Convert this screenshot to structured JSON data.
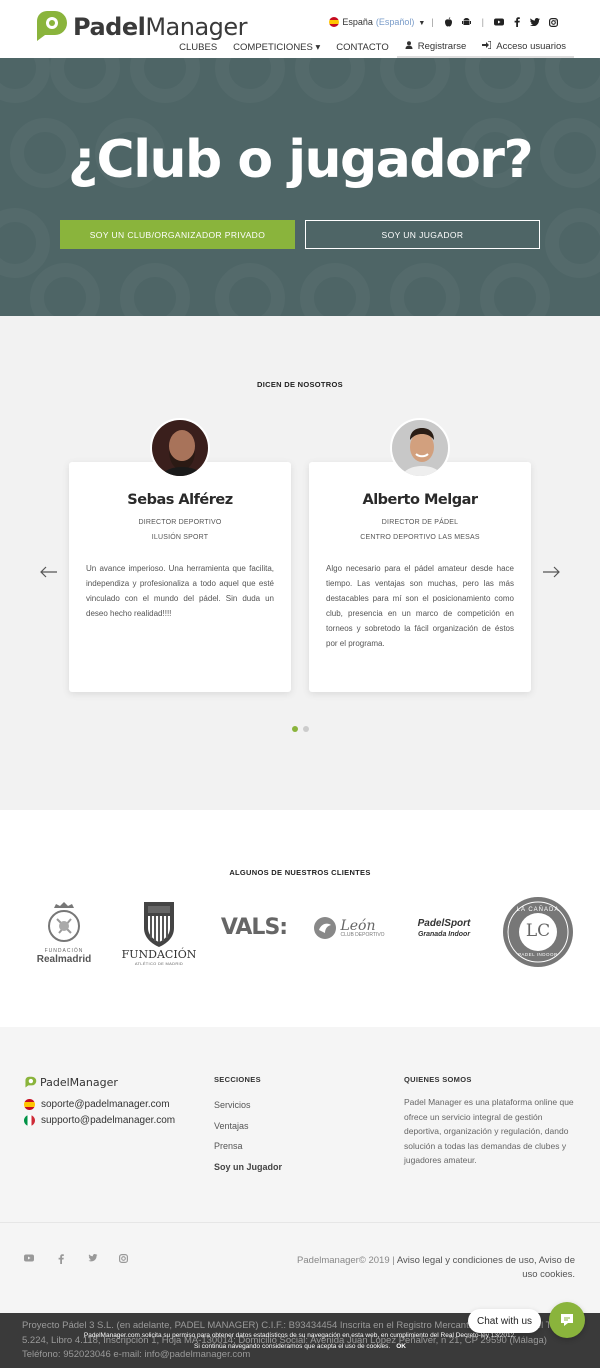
{
  "header": {
    "logo": {
      "bold": "Padel",
      "rest": "Manager"
    },
    "language": {
      "label": "España",
      "paren": "(Español)"
    },
    "nav": [
      {
        "label": "CLUBES"
      },
      {
        "label": "COMPETICIONES ▾"
      },
      {
        "label": "CONTACTO"
      },
      {
        "label": "Registrarse"
      },
      {
        "label": "Acceso usuarios"
      }
    ]
  },
  "hero": {
    "title": "¿Club o jugador?",
    "btn_club": "SOY UN CLUB/ORGANIZADOR PRIVADO",
    "btn_player": "SOY UN JUGADOR"
  },
  "testimonials": {
    "title": "DICEN DE NOSOTROS",
    "items": [
      {
        "name": "Sebas Alférez",
        "role": "DIRECTOR DEPORTIVO",
        "org": "ILUSIÓN SPORT",
        "quote": "Un avance imperioso. Una herramienta que facilita, independiza y profesionaliza a todo aquel que esté vinculado con el mundo del pádel. Sin duda un deseo hecho realidad!!!!"
      },
      {
        "name": "Alberto Melgar",
        "role": "DIRECTOR DE PÁDEL",
        "org": "CENTRO DEPORTIVO LAS MESAS",
        "quote": "Algo necesario para el pádel amateur desde hace tiempo. Las ventajas son muchas, pero las más destacables para mí son el posicionamiento como club, presencia en un marco de competición en torneos y sobretodo la fácil organización de éstos por el programa."
      }
    ]
  },
  "clients": {
    "title": "ALGUNOS DE NUESTROS CLIENTES",
    "logos": [
      {
        "line1": "FUNDACIÓN",
        "line2": "Realmadrid"
      },
      {
        "line1": "FUNDACIÓN",
        "line2": "ATLÉTICO DE MADRID"
      },
      {
        "line1": "VALS:"
      },
      {
        "line1": "León",
        "line2": "CLUB DEPORTIVO"
      },
      {
        "line1": "PadelSport",
        "line2": "Granada Indoor"
      },
      {
        "line1": "LA CAÑADA",
        "line2": "LC",
        "line3": "PADEL INDOOR"
      }
    ]
  },
  "footer": {
    "logo": "PadelManager",
    "emails": [
      "soporte@padelmanager.com",
      "supporto@padelmanager.com"
    ],
    "sections_title": "SECCIONES",
    "sections": [
      "Servicios",
      "Ventajas",
      "Prensa",
      "Soy un Jugador"
    ],
    "about_title": "QUIENES SOMOS",
    "about_text": "Padel Manager es una plataforma online que ofrece un servicio integral de gestión deportiva, organización y regulación, dando solución a todas las demandas de clubes y jugadores amateur.",
    "copyright": "Padelmanager© 2019 |",
    "legal_link": "Aviso legal y condiciones de uso, Aviso de uso cookies."
  },
  "legal": {
    "text": "Proyecto Pádel 3 S.L. (en adelante, PADEL MANAGER) C.I.F.: B93434454 Inscrita en el Registro Mercantil de Málaga en el Tomo 5.224, Libro 4.118, Inscripción 1, Hoja MA-130014; Domicilio Social: Avenida Juan López Peñalver, n 21, CP 29590 (Málaga) Teléfono: 952023046 e-mail: info@padelmanager.com"
  },
  "cookie": {
    "line1": "PadelManager.com solicita su permiso para obtener datos estadísticos de su navegación en esta web, en cumplimiento del Real Decreto-ley 13/2012.",
    "line2": "Si continúa navegando consideramos que acepta el uso de cookies.",
    "ok": "OK"
  },
  "chat": {
    "label": "Chat with us"
  },
  "colors": {
    "accent": "#8ab43c",
    "hero_bg": "#4e6566",
    "legal_bg": "#3a3a3a"
  }
}
